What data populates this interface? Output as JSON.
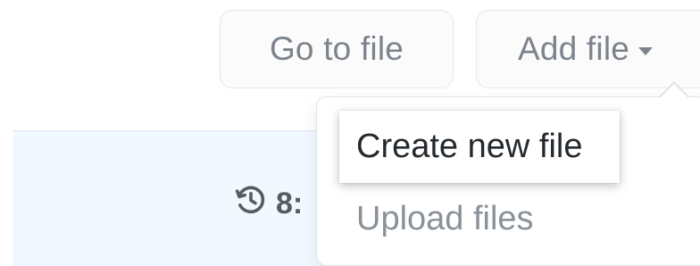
{
  "toolbar": {
    "go_to_file_label": "Go to file",
    "add_file_label": "Add file",
    "add_file_icon": "caret-down-icon"
  },
  "file_row": {
    "history_icon": "history-icon",
    "commit_count_partial": "8:"
  },
  "add_file_menu": {
    "items": [
      {
        "label": "Create new file",
        "highlighted": true
      },
      {
        "label": "Upload files",
        "highlighted": false
      }
    ]
  },
  "colors": {
    "button_text": "#7c838a",
    "button_border": "#e3e6ea",
    "row_background": "#f1f8ff",
    "menu_text_active": "#24292e",
    "menu_text_muted": "#8a9198"
  }
}
